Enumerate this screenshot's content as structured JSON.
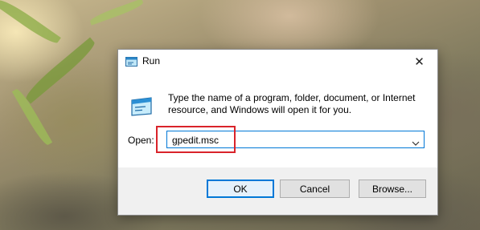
{
  "dialog": {
    "title": "Run",
    "close_glyph": "✕",
    "description": "Type the name of a program, folder, document, or Internet resource, and Windows will open it for you.",
    "open_label": "Open:",
    "open_value": "gpedit.msc",
    "buttons": {
      "ok": "OK",
      "cancel": "Cancel",
      "browse": "Browse..."
    }
  },
  "colors": {
    "accent": "#0078d7",
    "highlight_box": "#d9232a"
  },
  "icons": [
    "run-icon",
    "close-icon",
    "chevron-down-icon"
  ]
}
